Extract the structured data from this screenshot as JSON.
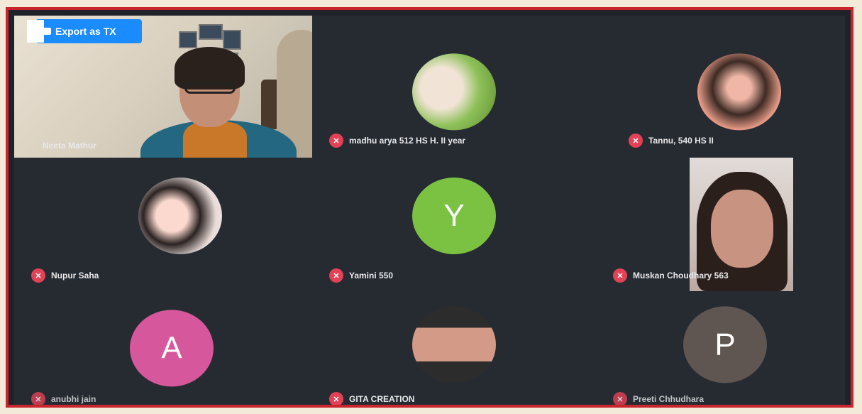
{
  "toolbar": {
    "export_label": "Export as TX"
  },
  "participants": [
    {
      "name": "Neeta Mathur",
      "type": "video"
    },
    {
      "name": "madhu arya 512 HS H. II year",
      "type": "photo"
    },
    {
      "name": "Tannu, 540 HS II",
      "type": "photo"
    },
    {
      "name": "Nupur Saha",
      "type": "photo"
    },
    {
      "name": "Yamini 550",
      "type": "initial",
      "initial": "Y",
      "color": "#7bc243"
    },
    {
      "name": "Muskan Choudhary 563",
      "type": "video"
    },
    {
      "name": "anubhi jain",
      "type": "initial",
      "initial": "A",
      "color": "#d6579b"
    },
    {
      "name": "GITA CREATION",
      "type": "photo"
    },
    {
      "name": "Preeti Chhudhara",
      "type": "initial",
      "initial": "P",
      "color": "#5f5652"
    }
  ],
  "colors": {
    "frame": "#c8262c",
    "background": "#262b32",
    "mic_badge": "#e34256",
    "export_button": "#1a8cff"
  }
}
